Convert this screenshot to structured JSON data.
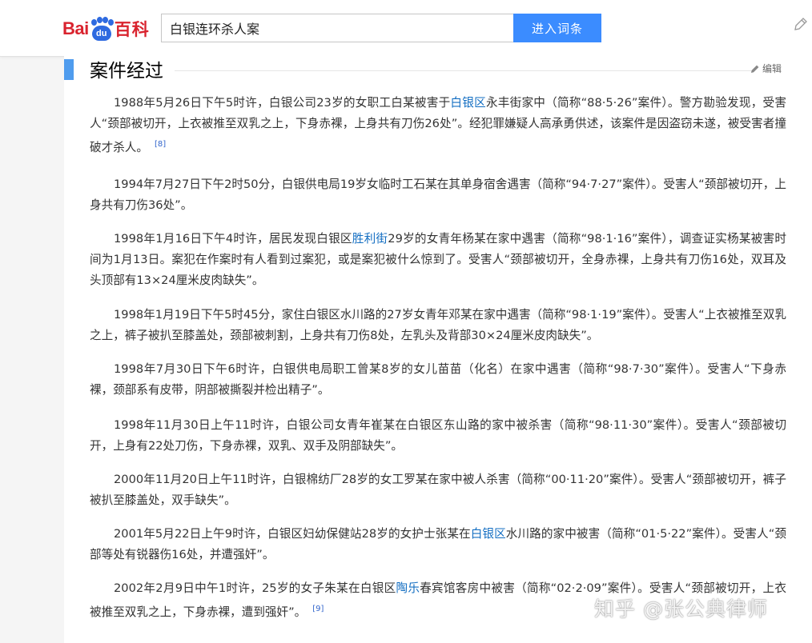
{
  "header": {
    "logo_bai": "Bai",
    "logo_du": "du",
    "logo_baike": "百科",
    "search_value": "白银连环杀人案",
    "search_button": "进入词条"
  },
  "section": {
    "title": "案件经过",
    "edit_label": "编辑"
  },
  "paragraphs": [
    {
      "parts": [
        {
          "t": "1988年5月26日下午5时许，白银公司23岁的女职工白某被害于"
        },
        {
          "t": "白银区",
          "link": true
        },
        {
          "t": "永丰街家中（简称“88·5·26”案件）。警方勘验发现，受害人“颈部被切开，上衣被推至双乳之上，下身赤裸，上身共有刀伤26处”。经犯罪嫌疑人高承勇供述，该案件是因盗窃未遂，被受害者撞破才杀人。"
        },
        {
          "t": "[8]",
          "ref": true
        }
      ]
    },
    {
      "parts": [
        {
          "t": "1994年7月27日下午2时50分，白银供电局19岁女临时工石某在其单身宿舍遇害（简称“94·7·27”案件）。受害人“颈部被切开，上身共有刀伤36处”。"
        }
      ]
    },
    {
      "parts": [
        {
          "t": "1998年1月16日下午4时许，居民发现白银区"
        },
        {
          "t": "胜利街",
          "link": true
        },
        {
          "t": "29岁的女青年杨某在家中遇害（简称“98·1·16”案件），调查证实杨某被害时间为1月13日。案犯在作案时有人看到过案犯，或是案犯被什么惊到了。受害人“颈部被切开，全身赤裸，上身共有刀伤16处，双耳及头顶部有13×24厘米皮肉缺失”。"
        }
      ]
    },
    {
      "parts": [
        {
          "t": "1998年1月19日下午5时45分，家住白银区水川路的27岁女青年邓某在家中遇害（简称“98·1·19”案件）。受害人“上衣被推至双乳之上，裤子被扒至膝盖处，颈部被刺割，上身共有刀伤8处，左乳头及背部30×24厘米皮肉缺失”。"
        }
      ]
    },
    {
      "parts": [
        {
          "t": "1998年7月30日下午6时许，白银供电局职工曾某8岁的女儿苗苗（化名）在家中遇害（简称“98·7·30”案件）。受害人“下身赤裸，颈部系有皮带，阴部被撕裂并检出精子”。"
        }
      ]
    },
    {
      "parts": [
        {
          "t": "1998年11月30日上午11时许，白银公司女青年崔某在白银区东山路的家中被杀害（简称“98·11·30”案件）。受害人“颈部被切开，上身有22处刀伤，下身赤裸，双乳、双手及阴部缺失”。"
        }
      ]
    },
    {
      "parts": [
        {
          "t": "2000年11月20日上午11时许，白银棉纺厂28岁的女工罗某在家中被人杀害（简称“00·11·20”案件）。受害人“颈部被切开，裤子被扒至膝盖处，双手缺失”。"
        }
      ]
    },
    {
      "parts": [
        {
          "t": "2001年5月22日上午9时许，白银区妇幼保健站28岁的女护士张某在"
        },
        {
          "t": "白银区",
          "link": true
        },
        {
          "t": "水川路的家中被害（简称“01·5·22”案件）。受害人“颈部等处有锐器伤16处，并遭强奸”。"
        }
      ]
    },
    {
      "parts": [
        {
          "t": "2002年2月9日中午1时许，25岁的女子朱某在白银区"
        },
        {
          "t": "陶乐",
          "link": true
        },
        {
          "t": "春宾馆客房中被害（简称“02·2·09”案件）。受害人“颈部被切开，上衣被推至双乳之上，下身赤裸，遭到强奸”。"
        },
        {
          "t": "[9]",
          "ref": true
        }
      ]
    }
  ],
  "watermark": "知乎 @张公典律师",
  "colors": {
    "brand_red": "#d9232e",
    "brand_blue": "#2e6ae0",
    "button_blue": "#3b8cff",
    "link_blue": "#136ec2",
    "section_bar": "#4f9cee"
  },
  "icons": {
    "edit": "pencil-icon",
    "logo": "paw-icon"
  }
}
